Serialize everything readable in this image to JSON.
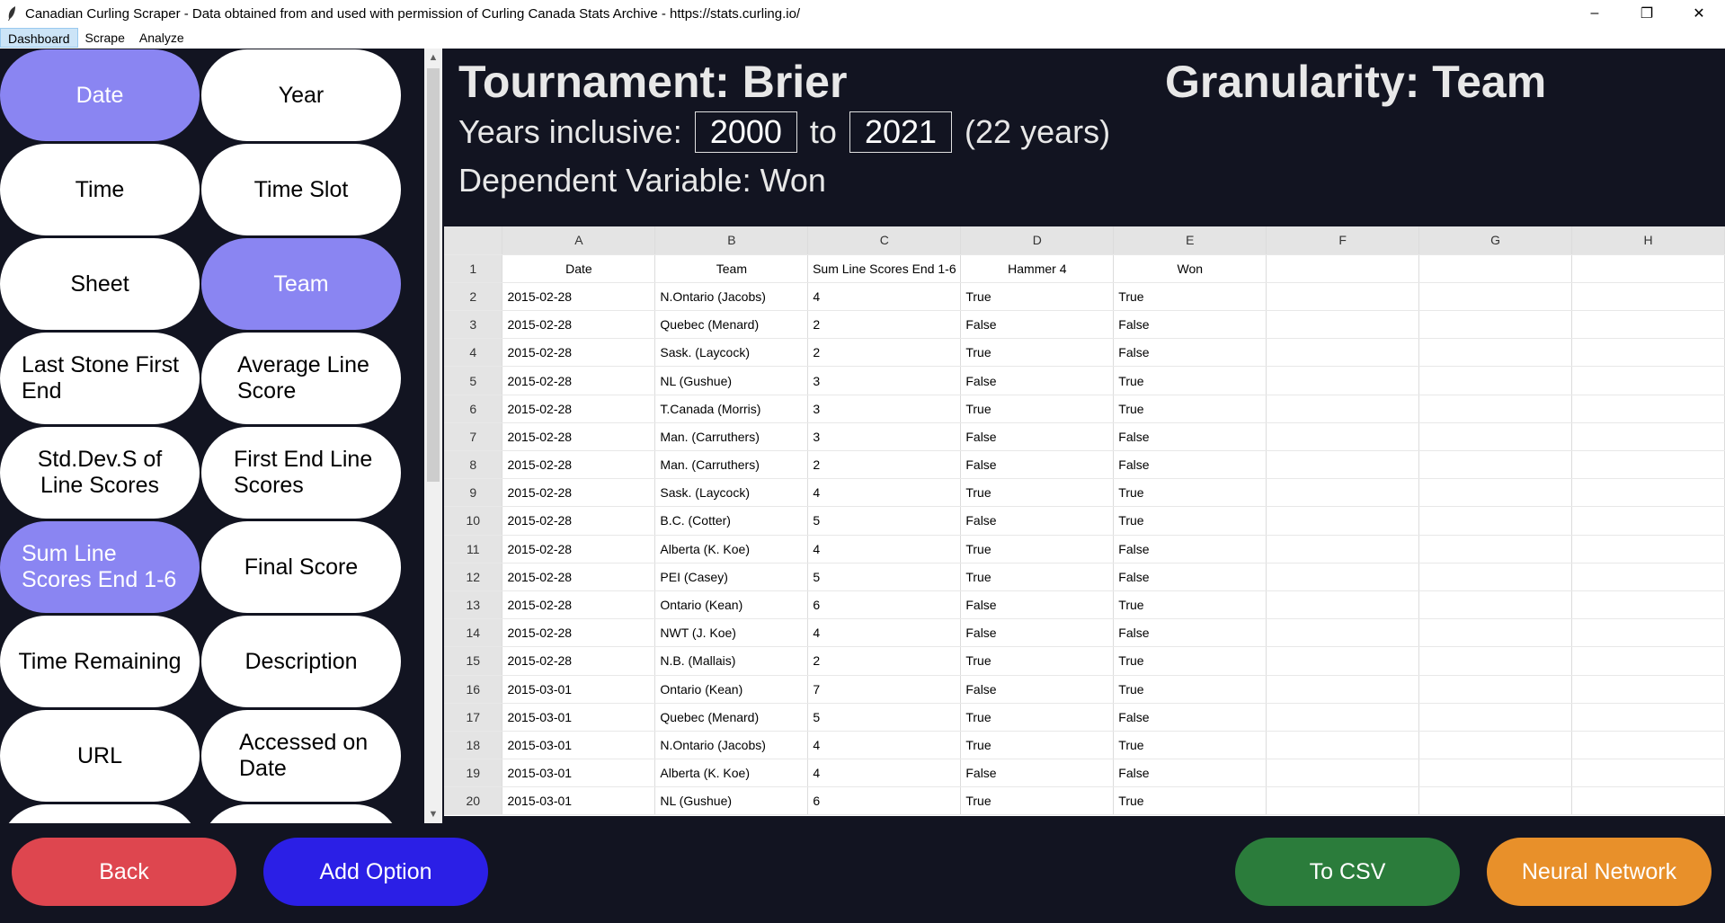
{
  "window": {
    "title": "Canadian Curling Scraper - Data obtained from and used with permission of Curling Canada Stats Archive - https://stats.curling.io/",
    "controls": [
      "–",
      "❐",
      "✕"
    ]
  },
  "menu": [
    "Dashboard",
    "Scrape",
    "Analyze"
  ],
  "options": [
    {
      "label": "Date",
      "selected": true
    },
    {
      "label": "Year",
      "selected": false
    },
    {
      "label": "Time",
      "selected": false
    },
    {
      "label": "Time Slot",
      "selected": false
    },
    {
      "label": "Sheet",
      "selected": false
    },
    {
      "label": "Team",
      "selected": true
    },
    {
      "label": "Last Stone First End",
      "selected": false
    },
    {
      "label": "Average Line Score",
      "selected": false
    },
    {
      "label": "Std.Dev.S of Line Scores",
      "selected": false
    },
    {
      "label": "First End Line Scores",
      "selected": false
    },
    {
      "label": "Sum Line Scores End 1-6",
      "selected": true
    },
    {
      "label": "Final Score",
      "selected": false
    },
    {
      "label": "Time Remaining",
      "selected": false
    },
    {
      "label": "Description",
      "selected": false
    },
    {
      "label": "URL",
      "selected": false
    },
    {
      "label": "Accessed on Date",
      "selected": false
    }
  ],
  "info": {
    "tournament": "Tournament:  Brier",
    "granularity": "Granularity:  Team",
    "years_label": "Years inclusive:",
    "year_from": "2000",
    "to_label": "to",
    "year_to": "2021",
    "years_count": "(22 years)",
    "dependent": "Dependent Variable:  Won"
  },
  "sheet": {
    "columns": [
      "A",
      "B",
      "C",
      "D",
      "E",
      "F",
      "G",
      "H"
    ],
    "header_row": [
      "Date",
      "Team",
      "Sum Line Scores End 1-6",
      "Hammer 4",
      "Won"
    ],
    "rows": [
      [
        "2015-02-28",
        "N.Ontario (Jacobs)",
        "4",
        "True",
        "True"
      ],
      [
        "2015-02-28",
        "Quebec (Menard)",
        "2",
        "False",
        "False"
      ],
      [
        "2015-02-28",
        "Sask. (Laycock)",
        "2",
        "True",
        "False"
      ],
      [
        "2015-02-28",
        "NL (Gushue)",
        "3",
        "False",
        "True"
      ],
      [
        "2015-02-28",
        "T.Canada (Morris)",
        "3",
        "True",
        "True"
      ],
      [
        "2015-02-28",
        "Man. (Carruthers)",
        "3",
        "False",
        "False"
      ],
      [
        "2015-02-28",
        "Man. (Carruthers)",
        "2",
        "False",
        "False"
      ],
      [
        "2015-02-28",
        "Sask. (Laycock)",
        "4",
        "True",
        "True"
      ],
      [
        "2015-02-28",
        "B.C. (Cotter)",
        "5",
        "False",
        "True"
      ],
      [
        "2015-02-28",
        "Alberta (K. Koe)",
        "4",
        "True",
        "False"
      ],
      [
        "2015-02-28",
        "PEI (Casey)",
        "5",
        "True",
        "False"
      ],
      [
        "2015-02-28",
        "Ontario (Kean)",
        "6",
        "False",
        "True"
      ],
      [
        "2015-02-28",
        "NWT (J. Koe)",
        "4",
        "False",
        "False"
      ],
      [
        "2015-02-28",
        "N.B. (Mallais)",
        "2",
        "True",
        "True"
      ],
      [
        "2015-03-01",
        "Ontario (Kean)",
        "7",
        "False",
        "True"
      ],
      [
        "2015-03-01",
        "Quebec (Menard)",
        "5",
        "True",
        "False"
      ],
      [
        "2015-03-01",
        "N.Ontario (Jacobs)",
        "4",
        "True",
        "True"
      ],
      [
        "2015-03-01",
        "Alberta (K. Koe)",
        "4",
        "False",
        "False"
      ],
      [
        "2015-03-01",
        "NL (Gushue)",
        "6",
        "True",
        "True"
      ]
    ]
  },
  "buttons": {
    "back": "Back",
    "add_option": "Add Option",
    "to_csv": "To CSV",
    "neural_network": "Neural Network"
  }
}
